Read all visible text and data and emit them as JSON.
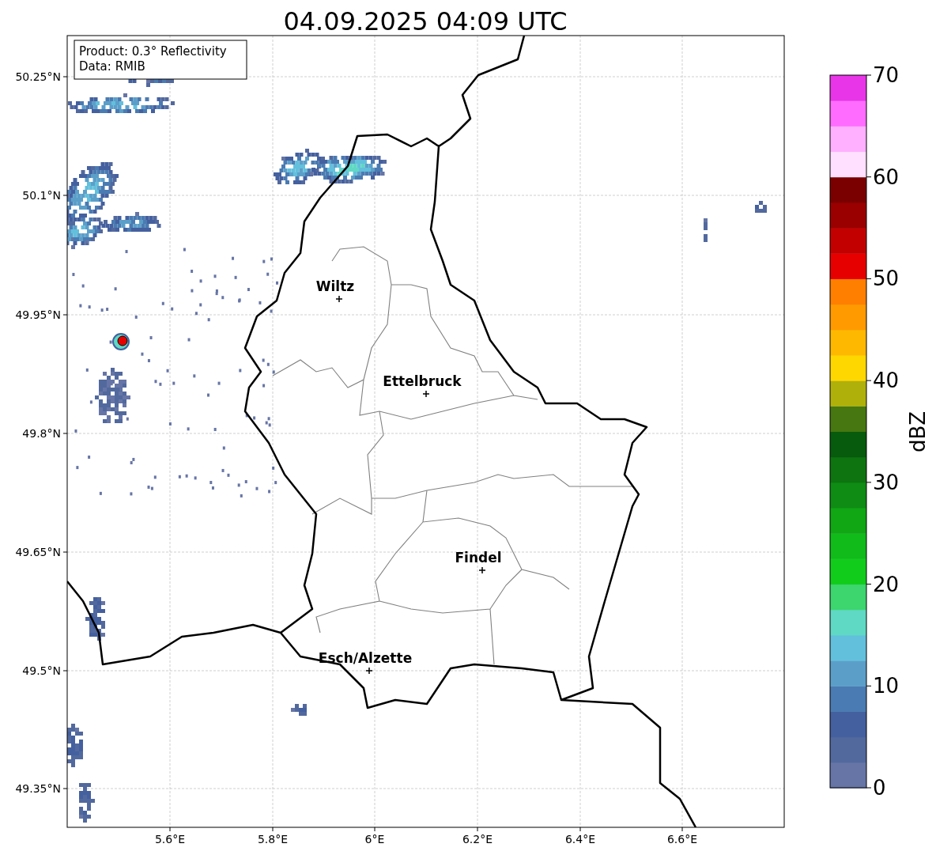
{
  "title": "04.09.2025 04:09 UTC",
  "legend": [
    "Product: 0.3° Reflectivity",
    "Data: RMIB"
  ],
  "map": {
    "cities": [
      {
        "name": "Wiltz"
      },
      {
        "name": "Ettelbruck"
      },
      {
        "name": "Findel"
      },
      {
        "name": "Esch/Alzette"
      }
    ],
    "x_ticks": [
      "5.6°E",
      "5.8°E",
      "6°E",
      "6.2°E",
      "6.4°E",
      "6.6°E"
    ],
    "y_ticks": [
      "50.25°N",
      "50.1°N",
      "49.95°N",
      "49.8°N",
      "49.65°N",
      "49.5°N",
      "49.35°N"
    ]
  },
  "colorbar": {
    "label": "dBZ",
    "ticks": [
      "70",
      "60",
      "50",
      "40",
      "30",
      "20",
      "10",
      "0"
    ]
  }
}
